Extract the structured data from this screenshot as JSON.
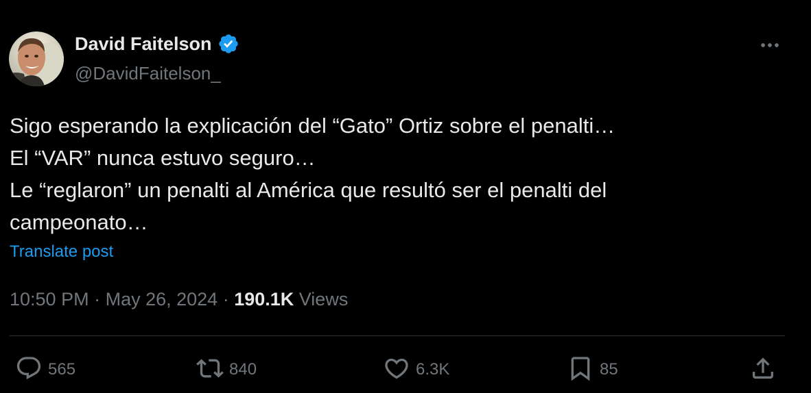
{
  "author": {
    "name": "David Faitelson",
    "handle": "@DavidFaitelson_"
  },
  "post": {
    "lines": [
      "Sigo esperando la explicación del “Gato” Ortiz sobre el penalti…",
      "El “VAR” nunca estuvo seguro…",
      "Le “reglaron” un penalti al América que resultó ser el penalti del",
      "campeonato…"
    ],
    "translate_label": "Translate post"
  },
  "meta": {
    "time": "10:50 PM",
    "separator": " · ",
    "date": "May 26, 2024",
    "views_count": "190.1K",
    "views_label": "Views"
  },
  "actions": {
    "replies": "565",
    "reposts": "840",
    "likes": "6.3K",
    "bookmarks": "85"
  },
  "icons": {
    "verified": "verified-badge-icon",
    "more": "more-icon",
    "reply": "reply-icon",
    "repost": "repost-icon",
    "like": "heart-icon",
    "bookmark": "bookmark-icon",
    "share": "share-icon"
  },
  "colors": {
    "background": "#000000",
    "text": "#e7e9ea",
    "secondary": "#71767b",
    "accent": "#1d9bf0",
    "divider": "#2f3336"
  }
}
